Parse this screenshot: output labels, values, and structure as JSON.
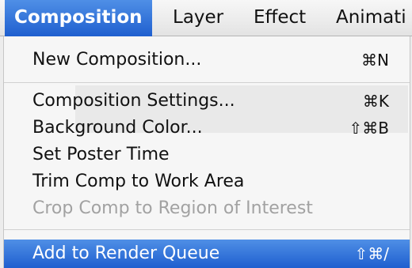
{
  "menubar": {
    "items": [
      {
        "label": "Composition"
      },
      {
        "label": "Layer"
      },
      {
        "label": "Effect"
      },
      {
        "label": "Animati"
      }
    ]
  },
  "menu": {
    "items": [
      {
        "label": "New Composition...",
        "shortcut": "⌘N",
        "enabled": true
      },
      {
        "label": "Composition Settings...",
        "shortcut": "⌘K",
        "enabled": true
      },
      {
        "label": "Background Color...",
        "shortcut": "⇧⌘B",
        "enabled": true
      },
      {
        "label": "Set Poster Time",
        "shortcut": "",
        "enabled": true
      },
      {
        "label": "Trim Comp to Work Area",
        "shortcut": "",
        "enabled": true
      },
      {
        "label": "Crop Comp to Region of Interest",
        "shortcut": "",
        "enabled": false
      },
      {
        "label": "Add to Render Queue",
        "shortcut": "⇧⌘/",
        "enabled": true,
        "highlighted": true
      }
    ]
  },
  "colors": {
    "highlight": "#2f6fd8",
    "disabled_text": "#a2a2a2"
  }
}
